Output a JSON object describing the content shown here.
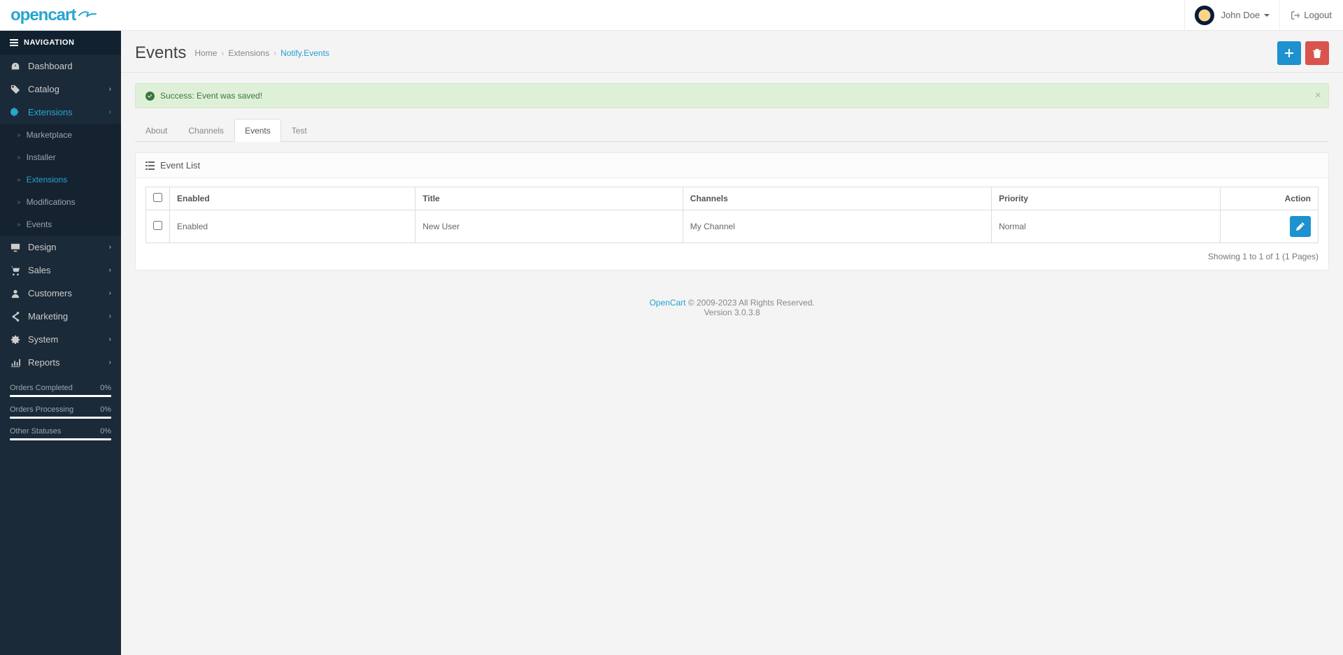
{
  "header": {
    "brand": "opencart",
    "user_name": "John Doe",
    "logout_label": "Logout"
  },
  "sidebar": {
    "title": "NAVIGATION",
    "items": [
      {
        "label": "Dashboard"
      },
      {
        "label": "Catalog"
      },
      {
        "label": "Extensions"
      },
      {
        "label": "Design"
      },
      {
        "label": "Sales"
      },
      {
        "label": "Customers"
      },
      {
        "label": "Marketing"
      },
      {
        "label": "System"
      },
      {
        "label": "Reports"
      }
    ],
    "extensions_sub": [
      {
        "label": "Marketplace"
      },
      {
        "label": "Installer"
      },
      {
        "label": "Extensions"
      },
      {
        "label": "Modifications"
      },
      {
        "label": "Events"
      }
    ],
    "stats": [
      {
        "label": "Orders Completed",
        "value": "0%"
      },
      {
        "label": "Orders Processing",
        "value": "0%"
      },
      {
        "label": "Other Statuses",
        "value": "0%"
      }
    ]
  },
  "page": {
    "title": "Events",
    "breadcrumb": [
      "Home",
      "Extensions",
      "Notify.Events"
    ]
  },
  "alert": {
    "message": "Success: Event was saved!"
  },
  "tabs": [
    "About",
    "Channels",
    "Events",
    "Test"
  ],
  "panel": {
    "heading": "Event List"
  },
  "table": {
    "headers": {
      "enabled": "Enabled",
      "title": "Title",
      "channels": "Channels",
      "priority": "Priority",
      "action": "Action"
    },
    "rows": [
      {
        "enabled": "Enabled",
        "title": "New User",
        "channels": "My Channel",
        "priority": "Normal"
      }
    ]
  },
  "pagination": "Showing 1 to 1 of 1 (1 Pages)",
  "footer": {
    "link": "OpenCart",
    "copyright": " © 2009-2023 All Rights Reserved.",
    "version": "Version 3.0.3.8"
  }
}
